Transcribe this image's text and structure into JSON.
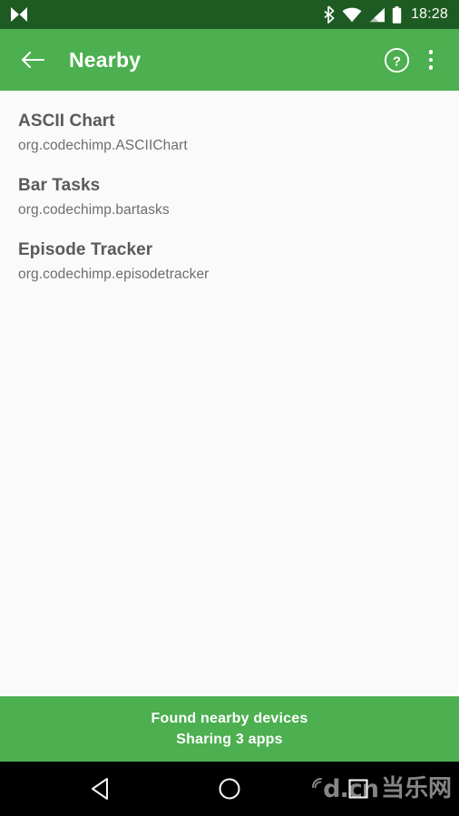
{
  "status_bar": {
    "background": "#1E5B22",
    "foreground": "#FFFFFF",
    "notification_icon": "bowtie-notification-icon",
    "icons": [
      "bluetooth-icon",
      "wifi-icon",
      "cellular-signal-icon",
      "battery-icon"
    ],
    "clock": "18:28"
  },
  "app_bar": {
    "background": "#4CAF50",
    "back_icon": "back-arrow-icon",
    "title": "Nearby",
    "help_icon": "help-circle-icon",
    "overflow_icon": "overflow-menu-icon"
  },
  "list": {
    "background": "#FAFAFA",
    "items": [
      {
        "title": "ASCII Chart",
        "package": "org.codechimp.ASCIIChart"
      },
      {
        "title": "Bar Tasks",
        "package": "org.codechimp.bartasks"
      },
      {
        "title": "Episode Tracker",
        "package": "org.codechimp.episodetracker"
      }
    ]
  },
  "banner": {
    "background": "#4CAF50",
    "line1": "Found nearby devices",
    "line2": "Sharing 3 apps"
  },
  "nav_bar": {
    "background": "#000000",
    "back_icon": "nav-back-triangle-icon",
    "home_icon": "nav-home-circle-icon",
    "recents_icon": "nav-recents-square-icon"
  },
  "watermark": {
    "text": "d.cn",
    "text_cn": "当乐网"
  }
}
